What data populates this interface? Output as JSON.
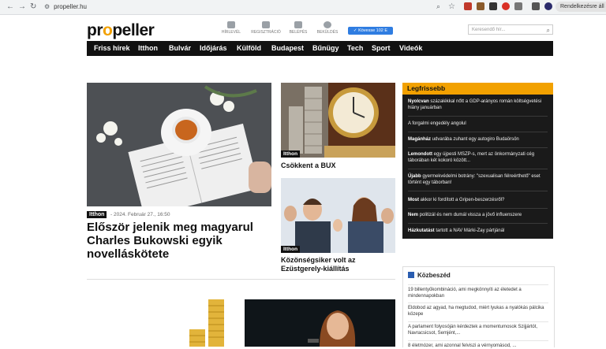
{
  "browser": {
    "url": "propeller.hu",
    "profile_label": "Rendelkezésre áll az"
  },
  "site": {
    "logo_pre": "pr",
    "logo_o": "o",
    "logo_post": "peller"
  },
  "header_icons": [
    {
      "label": "HÍRLEVÉL",
      "icon": "envelope-icon"
    },
    {
      "label": "REGISZTRÁCIÓ",
      "icon": "user-add-icon"
    },
    {
      "label": "BELÉPÉS",
      "icon": "lock-icon"
    },
    {
      "label": "BEKÜLDÉS",
      "icon": "plus-circle-icon"
    }
  ],
  "weather": {
    "label": "Kövesse 102 E"
  },
  "search": {
    "placeholder": "Keresendő hír..."
  },
  "nav": [
    "Friss hírek",
    "Itthon",
    "Bulvár",
    "Időjárás",
    "Külföld",
    "Budapest",
    "Bűnügy",
    "Tech",
    "Sport",
    "Videók"
  ],
  "main_article": {
    "tag": "Itthon",
    "date": "- 2024. Február 27., 16:50",
    "title": "Először jelenik meg magyarul Charles Bukowski egyik novelláskötete"
  },
  "mid_articles": [
    {
      "tag": "Itthon",
      "title": "Csökkent a BUX"
    },
    {
      "tag": "Itthon",
      "title": "Közönségsiker volt az Ezüstgerely-kiállítás"
    }
  ],
  "legfrissebb": {
    "title": "Legfrissebb",
    "items": [
      {
        "bold": "Nyolcvan",
        "text": " százalékkal nőtt a GDP-arányos román költségvetési hiány januárban"
      },
      {
        "bold": "",
        "text": "A forgalmi engedély angolul"
      },
      {
        "bold": "Magánház",
        "text": " udvarába zuhant egy autogiro Budaörsön"
      },
      {
        "bold": "Lemondott",
        "text": " egy újpesti MSZP-s, mert az önkormányzati cég táborában két kokoró között..."
      },
      {
        "bold": "Újabb",
        "text": " gyermekvédelmi botrány: \"szexualisan félreérthető\" eset történt egy táborban!"
      },
      {
        "bold": "Most",
        "text": " akkor ki fordított a Gripen-beszerzésről?"
      },
      {
        "bold": "Nem",
        "text": " politizál és nem dumál vissza a jövő influenszere"
      },
      {
        "bold": "Házkutatást",
        "text": " tartott a NAV Márki-Zay pártjánál"
      }
    ]
  },
  "kozbeszed": {
    "title": "Közbeszéd",
    "items": [
      "19 billentyűkombináció, ami megkönnyíti az életedet a mindennapokban",
      "Eldobod az agyad, ha megtudod, miért lyukas a nyalókás pálcika közepe",
      "A parlament folyosóján kérdeztek a momentumosok Szijjártót, Navracsicsot, Semjént,...",
      "8 életmózer, ami azonnal felviszi a vérnyomásod, ..."
    ]
  }
}
